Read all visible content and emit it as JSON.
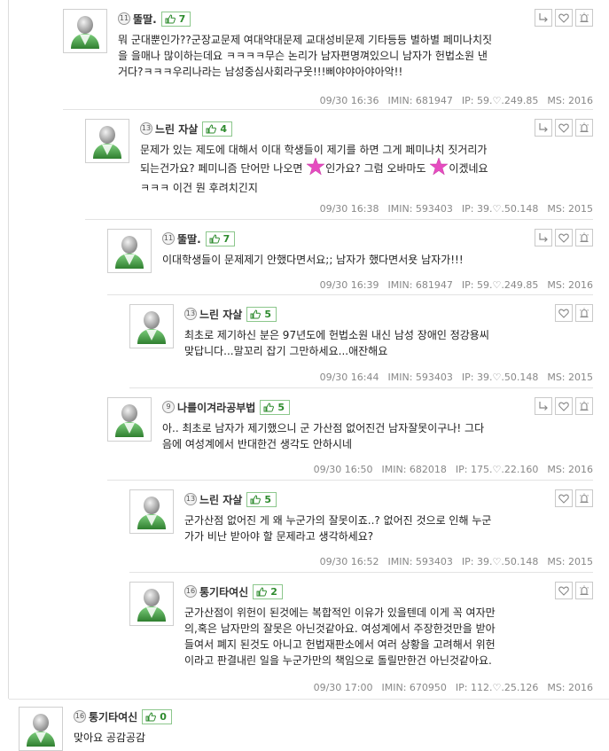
{
  "comments": [
    {
      "nick": "뚤딸.",
      "level": "11",
      "likes": "7",
      "lines": [
        "뭐 군대뿐인가??군장교문제 여대약대문제 교대성비문제 기타등등 별하별 페미나치짓",
        "을 을매나 많이하는데요 ㅋㅋㅋㅋ무슨 논리가 남자편명껴있으니 남자가 헌법소원 낸",
        "거다?ㅋㅋㅋ우리나라는 남성중심사회라구웃!!!삐야야아야아악!!"
      ],
      "date": "09/30 16:36",
      "imin": "IMIN: 681947",
      "ip": "IP: 59.♡.249.85",
      "ms": "MS: 2016"
    },
    {
      "nick": "느린 자살",
      "level": "13",
      "likes": "4",
      "line1": "문제가 있는 제도에 대해서 이대 학생들이 제기를 하면 그게 페미나치 짓거리가",
      "line2a": "되는건가요? 페미니즘 단어만 나오면 ",
      "line2b": "인가요? 그럼 오바마도 ",
      "line2c": "이겠네요",
      "line3": "ㅋㅋㅋ 이건 뭔 후려치긴지",
      "date": "09/30 16:38",
      "imin": "IMIN: 593403",
      "ip": "IP: 39.♡.50.148",
      "ms": "MS: 2015"
    },
    {
      "nick": "뚤딸.",
      "level": "11",
      "likes": "7",
      "lines": [
        "이대학생들이 문제제기 안했다면서요;; 남자가 했다면서욧 남자가!!!"
      ],
      "date": "09/30 16:39",
      "imin": "IMIN: 681947",
      "ip": "IP: 59.♡.249.85",
      "ms": "MS: 2016"
    },
    {
      "nick": "느린 자살",
      "level": "13",
      "likes": "5",
      "lines": [
        "최초로 제기하신 분은 97년도에 헌법소원 내신 남성 장애인 정강용씨",
        "맞답니다...말꼬리 잡기 그만하세요...애잔해요"
      ],
      "date": "09/30 16:44",
      "imin": "IMIN: 593403",
      "ip": "IP: 39.♡.50.148",
      "ms": "MS: 2015"
    },
    {
      "nick": "나를이겨라공부법",
      "level": "9",
      "likes": "5",
      "lines": [
        "아.. 최초로 남자가 제기했으니 군 가산점 없어진건 남자잘못이구나!  그다",
        "음에 여성계에서 반대한건 생각도 안하시네"
      ],
      "date": "09/30 16:50",
      "imin": "IMIN: 682018",
      "ip": "IP: 175.♡.22.160",
      "ms": "MS: 2016"
    },
    {
      "nick": "느린 자살",
      "level": "13",
      "likes": "5",
      "lines": [
        "군가산점 없어진 게 왜 누군가의 잘못이죠..? 없어진 것으로 인해 누군",
        "가가 비난 받아야 할 문제라고 생각하세요?"
      ],
      "date": "09/30 16:52",
      "imin": "IMIN: 593403",
      "ip": "IP: 39.♡.50.148",
      "ms": "MS: 2015"
    },
    {
      "nick": "통기타여신",
      "level": "16",
      "likes": "2",
      "lines": [
        "군가산점이 위헌이 된것에는 복합적인 이유가 있을텐데 이게 꼭 여자만",
        "의,혹은 남자만의 잘못은 아닌것같아요. 여성계에서 주장한것만을 받아",
        "들여서 폐지 된것도 아니고 헌법재판소에서 여러 상황을 고려해서 위헌",
        "이라고 판결내린 일을 누군가만의 책임으로 돌릴만한건 아닌것같아요."
      ],
      "date": "09/30 17:00",
      "imin": "IMIN: 670950",
      "ip": "IP: 112.♡.25.126",
      "ms": "MS: 2016"
    },
    {
      "nick": "통기타여신",
      "level": "16",
      "likes": "0",
      "lines": [
        "맞아요 공감공감"
      ]
    }
  ],
  "colors": {
    "likeGreen": "#2e8b2e",
    "likeBorder": "#8cc78c",
    "star": "#e64bc0",
    "meta": "#888888"
  },
  "icons": {
    "reply": "reply-arrow-icon",
    "like": "heart-icon",
    "report": "siren-icon",
    "thumb": "thumb-up-icon"
  }
}
